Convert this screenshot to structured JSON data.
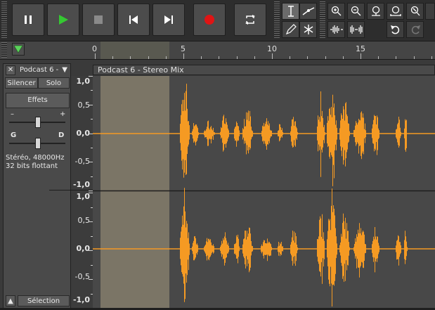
{
  "toolbar": {
    "transport": [
      {
        "name": "pause-button",
        "icon": "pause-icon"
      },
      {
        "name": "play-button",
        "icon": "play-icon"
      },
      {
        "name": "stop-button",
        "icon": "stop-icon"
      },
      {
        "name": "skip-start-button",
        "icon": "skip-start-icon"
      },
      {
        "name": "skip-end-button",
        "icon": "skip-end-icon"
      },
      {
        "name": "record-button",
        "icon": "record-icon"
      },
      {
        "name": "loop-button",
        "icon": "loop-icon"
      }
    ],
    "colors": {
      "play": "#35c832",
      "record": "#e01414"
    }
  },
  "ruler": {
    "ticks": [
      "0",
      "5",
      "10",
      "15"
    ],
    "selection_start_seconds": 0.35,
    "selection_end_seconds": 4.25
  },
  "track": {
    "name": "Podcast 6 -",
    "mute_label": "Silencer",
    "solo_label": "Solo",
    "effects_label": "Effets",
    "gain_minus": "–",
    "gain_plus": "+",
    "pan_left": "G",
    "pan_right": "D",
    "info_line1": "Stéréo, 48000Hz",
    "info_line2": "32 bits flottant",
    "select_label": "Sélection"
  },
  "clip": {
    "title": "Podcast 6 - Stereo Mix",
    "waveform_color": "#f59a23"
  },
  "scale": {
    "labels_top": [
      "1,0",
      "0,5",
      "0,0",
      "-0,5",
      "-1,0"
    ],
    "labels_bottom": [
      "1,0",
      "0,5",
      "0,0",
      "-0,5",
      "-1,0"
    ]
  }
}
